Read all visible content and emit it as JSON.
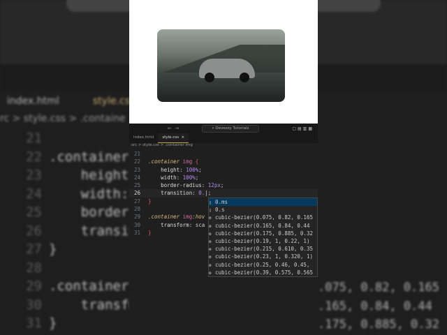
{
  "background": {
    "tabs": [
      "index.html",
      "style.css"
    ],
    "crumb": "rc > style.css > .containe",
    "lines": [
      {
        "n": "21",
        "t": ""
      },
      {
        "n": "22",
        "t": ".container"
      },
      {
        "n": "23",
        "t": "    height"
      },
      {
        "n": "24",
        "t": "    width:"
      },
      {
        "n": "25",
        "t": "    border-"
      },
      {
        "n": "26",
        "t": "    transit"
      },
      {
        "n": "27",
        "t": "}"
      },
      {
        "n": "28",
        "t": ""
      },
      {
        "n": "29",
        "t": ".container"
      },
      {
        "n": "30",
        "t": "    transfo"
      },
      {
        "n": "31",
        "t": "}"
      }
    ],
    "right": [
      ".075, 0.82, 0.165",
      ".165, 0.84, 0.44",
      ".175, 0.885, 0.32"
    ]
  },
  "editor": {
    "search": "Devezzy Tutorials",
    "tabs": [
      {
        "label": "index.html"
      },
      {
        "label": "style.css",
        "close": "×"
      }
    ],
    "breadcrumb": "src > style.css > .container img",
    "lines": [
      {
        "n": "21",
        "html": ""
      },
      {
        "n": "22",
        "html": "<span class='sel'>.container</span> <span class='tag'>img</span> <span class='br'>{</span>"
      },
      {
        "n": "23",
        "html": "    <span class='prop'>height</span>: <span class='num'>100%</span>;"
      },
      {
        "n": "24",
        "html": "    <span class='prop'>width</span>: <span class='num'>100%</span>;"
      },
      {
        "n": "25",
        "html": "    <span class='prop'>border-radius</span>: <span class='num'>12px</span>;"
      },
      {
        "n": "26",
        "html": "    <span class='prop'>transition</span>: <span class='num'>0.</span>|;"
      },
      {
        "n": "27",
        "html": "<span class='br'>}</span>"
      },
      {
        "n": "28",
        "html": ""
      },
      {
        "n": "29",
        "html": "<span class='sel'>.container</span> <span class='tag'>img</span><span class='sel'>:hov</span>"
      },
      {
        "n": "30",
        "html": "    <span class='prop'>transform</span>: sca"
      },
      {
        "n": "31",
        "html": "<span class='br'>}</span>"
      }
    ],
    "suggestions": [
      "0.ms",
      "0.s",
      "cubic-bezier(0.075, 0.82, 0.165",
      "cubic-bezier(0.165, 0.84, 0.44",
      "cubic-bezier(0.175, 0.885, 0.32",
      "cubic-bezier(0.19, 1, 0.22, 1)",
      "cubic-bezier(0.215, 0.610, 0.35",
      "cubic-bezier(0.23, 1, 0.320, 1)",
      "cubic-bezier(0.25, 0.46, 0.45,",
      "cubic-bezier(0.39, 0.575, 0.565"
    ]
  }
}
